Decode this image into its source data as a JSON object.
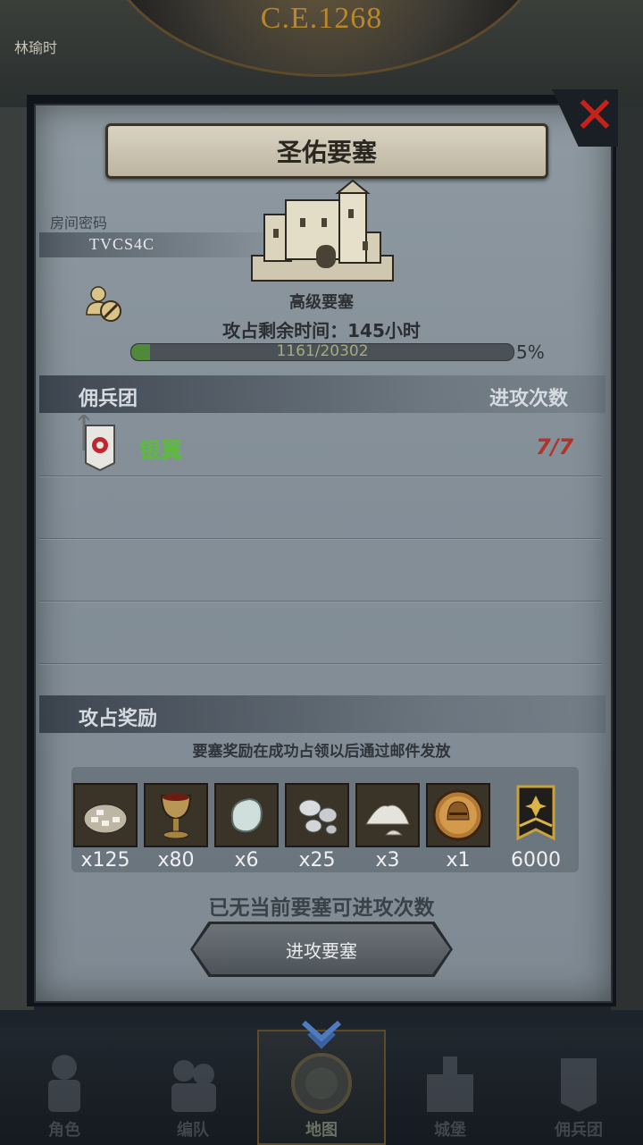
{
  "background": {
    "era": "C.E.1268",
    "side_text": "林瑜时"
  },
  "dialog": {
    "title": "圣佑要塞",
    "room_code_label": "房间密码",
    "room_code": "TVCS4C",
    "fortress_type": "高级要塞",
    "time_remaining": "攻占剩余时间：145小时",
    "progress": {
      "text": "1161/20302",
      "percent_label": "5%",
      "fraction": 0.05
    },
    "mercenary_header": "佣兵团",
    "attacks_header": "进攻次数",
    "guilds": [
      {
        "name": "银翼",
        "attacks": "7/7"
      }
    ],
    "rewards_header": "攻占奖励",
    "rewards_note": "要塞奖励在成功占领以后通过邮件发放",
    "rewards": [
      {
        "icon": "ore-icon",
        "count": "x125"
      },
      {
        "icon": "goblet-icon",
        "count": "x80"
      },
      {
        "icon": "gem-icon",
        "count": "x6"
      },
      {
        "icon": "silver-icon",
        "count": "x25"
      },
      {
        "icon": "salt-icon",
        "count": "x3"
      },
      {
        "icon": "helmet-medal-icon",
        "count": "x1"
      },
      {
        "icon": "banner-icon",
        "count": "6000"
      }
    ],
    "no_attack_message": "已无当前要塞可进攻次数",
    "attack_button": "进攻要塞"
  },
  "nav": [
    {
      "label": "角色",
      "icon": "knight-icon"
    },
    {
      "label": "编队",
      "icon": "formation-icon"
    },
    {
      "label": "地图",
      "icon": "map-icon",
      "active": true
    },
    {
      "label": "城堡",
      "icon": "castle-icon"
    },
    {
      "label": "佣兵团",
      "icon": "mercenary-icon"
    }
  ],
  "colors": {
    "guild_name": "#5dbb3c",
    "attacks": "#b5322a",
    "progress_fill": "#4e8a3a",
    "close": "#c8211a"
  }
}
